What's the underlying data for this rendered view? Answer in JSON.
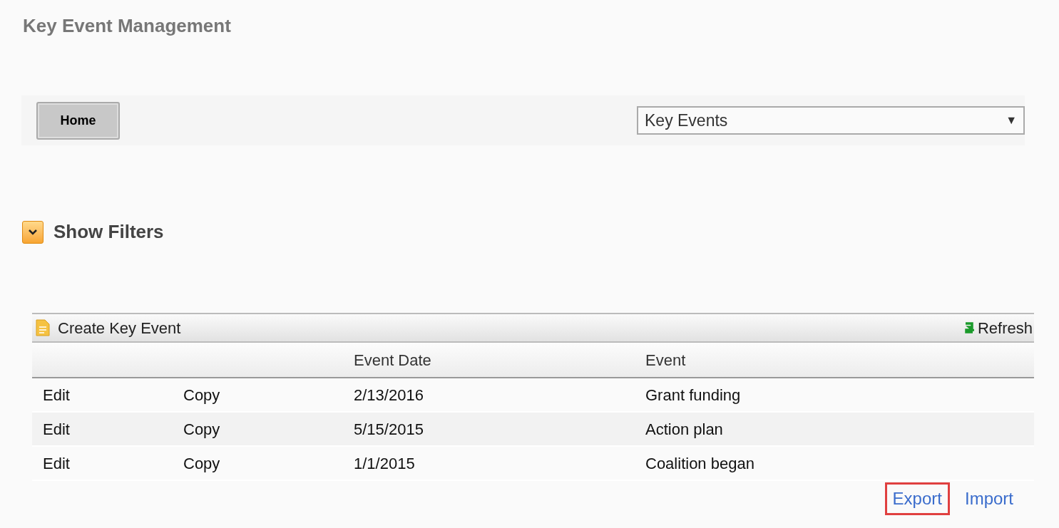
{
  "page_title": "Key Event Management",
  "nav": {
    "home_button": "Home",
    "view_select": {
      "value": "Key Events",
      "arrow": "▼"
    }
  },
  "filters": {
    "label": "Show Filters",
    "expanded": false
  },
  "grid": {
    "toolbar": {
      "create": "Create Key Event",
      "refresh": "Refresh"
    },
    "columns": [
      "",
      "",
      "Event Date",
      "Event"
    ],
    "rows": [
      {
        "edit": "Edit",
        "copy": "Copy",
        "event_date": "2/13/2016",
        "event": "Grant funding"
      },
      {
        "edit": "Edit",
        "copy": "Copy",
        "event_date": "5/15/2015",
        "event": "Action plan"
      },
      {
        "edit": "Edit",
        "copy": "Copy",
        "event_date": "1/1/2015",
        "event": "Coalition began"
      }
    ]
  },
  "footer_links": [
    {
      "label": "Export",
      "highlighted": true
    },
    {
      "label": "Import",
      "highlighted": false
    }
  ]
}
